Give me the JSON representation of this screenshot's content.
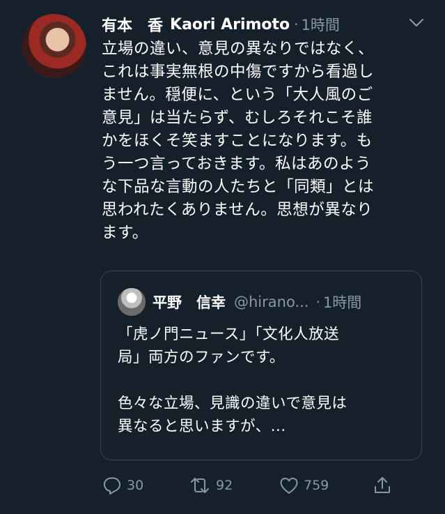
{
  "tweet": {
    "author_name": "有本　香",
    "author_handle": "Kaori Arimoto",
    "separator": "·",
    "time": "1時間",
    "text": "立場の違い、意見の異なりではなく、\nこれは事実無根の中傷ですから看過し\nません。穏便に、という「大人風のご\n意見」は当たらず、むしろそれこそ誰\nかをほくそ笑ますことになります。も\nう一つ言っておきます。私はあのよう\nな下品な言動の人たちと「同類」とは\n思われたくありません。思想が異なり\nます。"
  },
  "quote": {
    "author_name": "平野　信幸",
    "author_handle": "@hirano...",
    "separator": "·",
    "time": "1時間",
    "text": "「虎ノ門ニュース」「文化人放送\n局」両方のファンです。\n\n色々な立場、見識の違いで意見は\n異なると思いますが、..."
  },
  "actions": {
    "reply_count": "30",
    "retweet_count": "92",
    "like_count": "759"
  },
  "icons": {
    "more": "chevron-down-icon",
    "reply": "reply-icon",
    "retweet": "retweet-icon",
    "like": "heart-icon",
    "share": "share-icon"
  },
  "colors": {
    "background": "#15202b",
    "text": "#ffffff",
    "secondary": "#8899a6",
    "border": "#38444d"
  }
}
